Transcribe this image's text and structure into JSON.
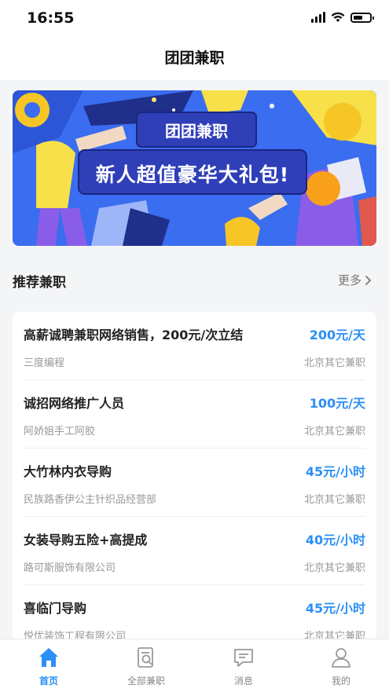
{
  "status_bar": {
    "time": "16:55"
  },
  "nav": {
    "title": "团团兼职"
  },
  "banner": {
    "tag": "团团兼职",
    "headline": "新人超值豪华大礼包!"
  },
  "section": {
    "title": "推荐兼职",
    "more_label": "更多"
  },
  "jobs": [
    {
      "title": "高薪诚聘兼职网络销售，200元/次立结",
      "price": "200元/天",
      "company": "三度编程",
      "location": "北京其它兼职"
    },
    {
      "title": "诚招网络推广人员",
      "price": "100元/天",
      "company": "阿娇姐手工阿胶",
      "location": "北京其它兼职"
    },
    {
      "title": "大竹林内衣导购",
      "price": "45元/小时",
      "company": "民族路香伊公主针织品经营部",
      "location": "北京其它兼职"
    },
    {
      "title": "女装导购五险+高提成",
      "price": "40元/小时",
      "company": "路可斯服饰有限公司",
      "location": "北京其它兼职"
    },
    {
      "title": "喜临门导购",
      "price": "45元/小时",
      "company": "悦优装饰工程有限公司",
      "location": "北京其它兼职"
    }
  ],
  "tabs": [
    {
      "label": "首页",
      "icon": "home-icon",
      "active": true
    },
    {
      "label": "全部兼职",
      "icon": "document-search-icon",
      "active": false
    },
    {
      "label": "消息",
      "icon": "message-icon",
      "active": false
    },
    {
      "label": "我的",
      "icon": "user-icon",
      "active": false
    }
  ],
  "colors": {
    "accent": "#2b8ff5",
    "banner_bg": "#3a6df0",
    "banner_label_bg": "#2f3fb8"
  }
}
